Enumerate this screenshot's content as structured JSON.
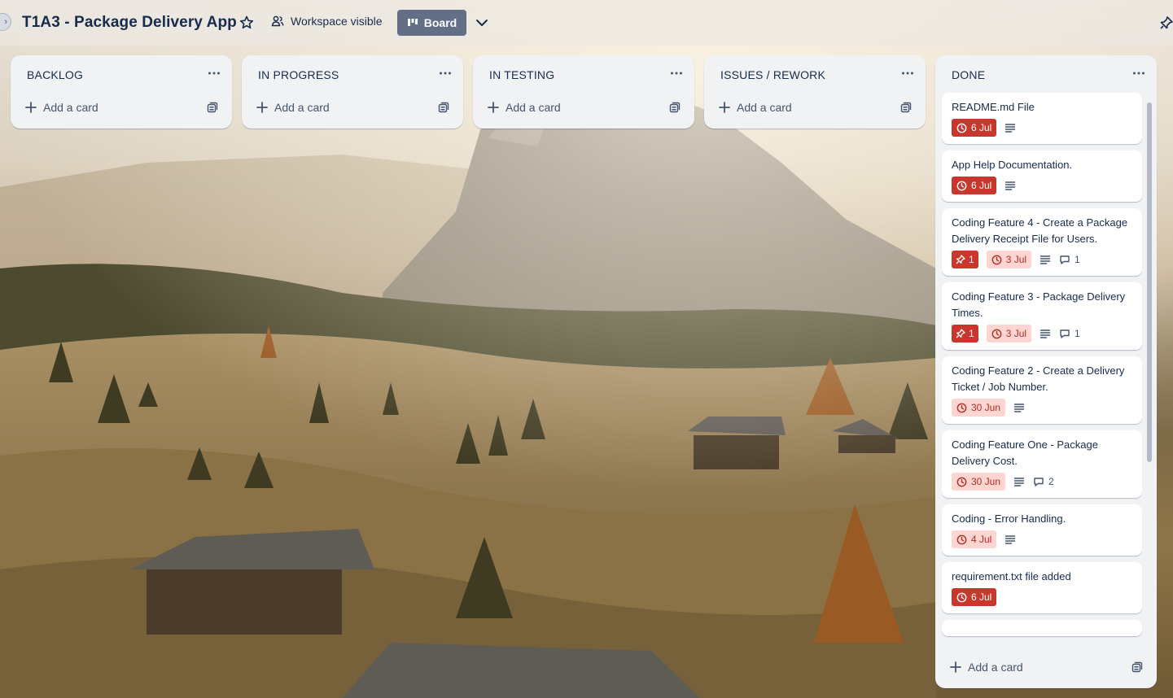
{
  "board": {
    "title": "T1A3 - Package Delivery App",
    "visibility": "Workspace visible",
    "view": "Board"
  },
  "icons": {
    "star": "star-icon",
    "visibility": "people-icon",
    "board": "board-icon",
    "chevron": "chevron-down-icon",
    "pin": "pin-icon",
    "menu": "more-icon",
    "plus": "plus-icon",
    "template": "template-icon",
    "clock": "clock-icon",
    "description": "description-icon",
    "comment": "comment-icon",
    "vote": "pin-vote-icon"
  },
  "colors": {
    "overdue": "#c9372c",
    "due_soon_bg": "#ffd5d2",
    "due_soon_text": "#ae2e24",
    "board_button": "#626f86"
  },
  "add_card_label": "Add a card",
  "lists": [
    {
      "title": "BACKLOG"
    },
    {
      "title": "IN PROGRESS"
    },
    {
      "title": "IN TESTING"
    },
    {
      "title": "ISSUES / REWORK"
    },
    {
      "title": "DONE"
    }
  ],
  "done_cards": [
    {
      "title": "README.md File",
      "due": "6 Jul",
      "due_status": "overdue",
      "description": true
    },
    {
      "title": "App Help Documentation.",
      "due": "6 Jul",
      "due_status": "overdue",
      "description": true
    },
    {
      "title": "Coding Feature 4 - Create a Package Delivery Receipt File for Users.",
      "votes": "1",
      "due": "3 Jul",
      "due_status": "soon",
      "description": true,
      "comments": "1"
    },
    {
      "title": "Coding Feature 3 - Package Delivery Times.",
      "votes": "1",
      "due": "3 Jul",
      "due_status": "soon",
      "description": true,
      "comments": "1"
    },
    {
      "title": "Coding Feature 2 - Create a Delivery Ticket / Job Number.",
      "due": "30 Jun",
      "due_status": "soon",
      "description": true
    },
    {
      "title": "Coding Feature One - Package Delivery Cost.",
      "due": "30 Jun",
      "due_status": "soon",
      "description": true,
      "comments": "2"
    },
    {
      "title": "Coding - Error Handling.",
      "due": "4 Jul",
      "due_status": "soon",
      "description": true
    },
    {
      "title": "requirement.txt file added",
      "due": "6 Jul",
      "due_status": "overdue"
    }
  ]
}
